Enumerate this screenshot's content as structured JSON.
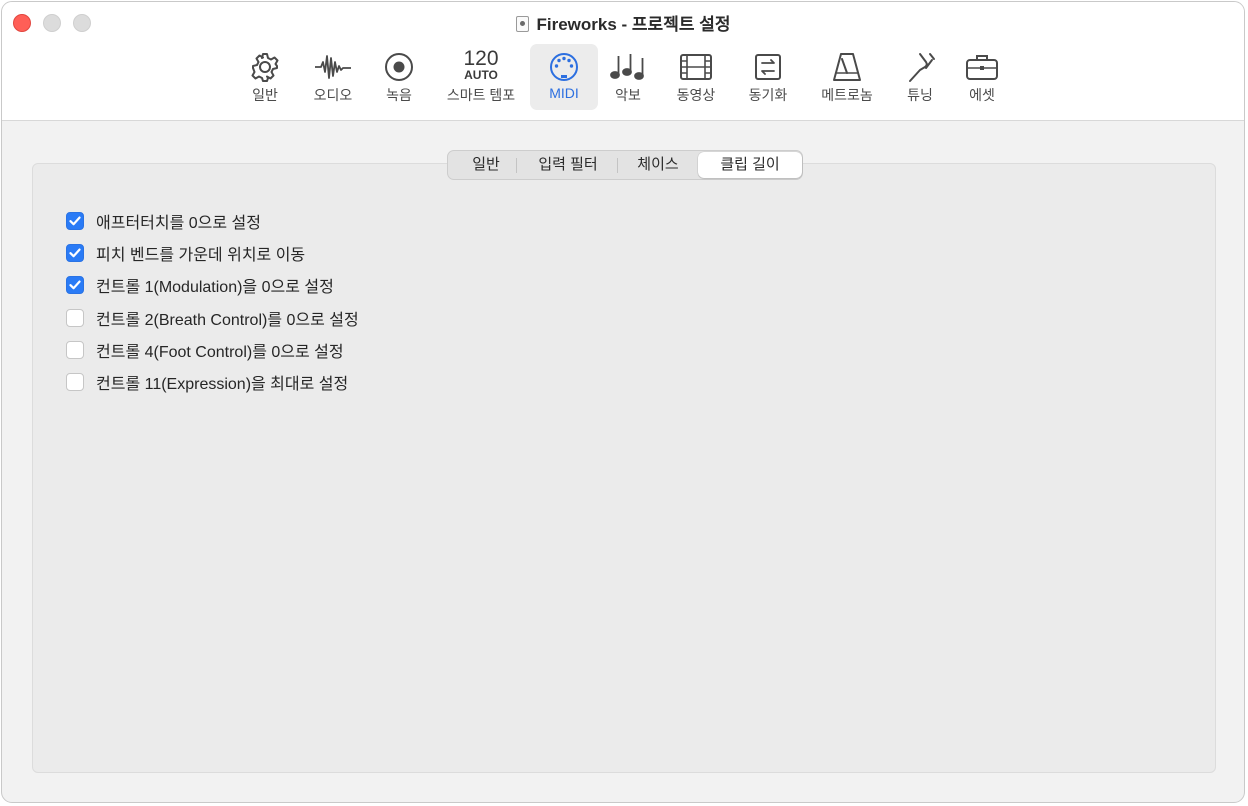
{
  "window": {
    "title": "Fireworks - 프로젝트 설정"
  },
  "toolbar": {
    "items": [
      {
        "label": "일반",
        "icon": "gear-icon"
      },
      {
        "label": "오디오",
        "icon": "waveform-icon"
      },
      {
        "label": "녹음",
        "icon": "record-icon"
      },
      {
        "label": "스마트 템포",
        "icon": "smart-tempo-icon",
        "top_text": "120",
        "bottom_text": "AUTO"
      },
      {
        "label": "MIDI",
        "icon": "midi-icon",
        "active": true
      },
      {
        "label": "악보",
        "icon": "score-notes-icon"
      },
      {
        "label": "동영상",
        "icon": "film-icon"
      },
      {
        "label": "동기화",
        "icon": "sync-icon"
      },
      {
        "label": "메트로놈",
        "icon": "metronome-icon"
      },
      {
        "label": "튜닝",
        "icon": "tuning-fork-icon"
      },
      {
        "label": "에셋",
        "icon": "briefcase-icon"
      }
    ]
  },
  "subtabs": [
    {
      "label": "일반",
      "selected": false
    },
    {
      "label": "입력 필터",
      "selected": false
    },
    {
      "label": "체이스",
      "selected": false
    },
    {
      "label": "클립 길이",
      "selected": true
    }
  ],
  "options": [
    {
      "label": "애프터터치를 0으로 설정",
      "checked": true
    },
    {
      "label": "피치 벤드를 가운데 위치로 이동",
      "checked": true
    },
    {
      "label": "컨트롤 1(Modulation)을 0으로 설정",
      "checked": true
    },
    {
      "label": "컨트롤 2(Breath Control)를 0으로 설정",
      "checked": false
    },
    {
      "label": "컨트롤 4(Foot Control)를 0으로 설정",
      "checked": false
    },
    {
      "label": "컨트롤 11(Expression)을 최대로 설정",
      "checked": false
    }
  ],
  "colors": {
    "accent": "#2a7bf6",
    "close": "#ff5f57"
  }
}
